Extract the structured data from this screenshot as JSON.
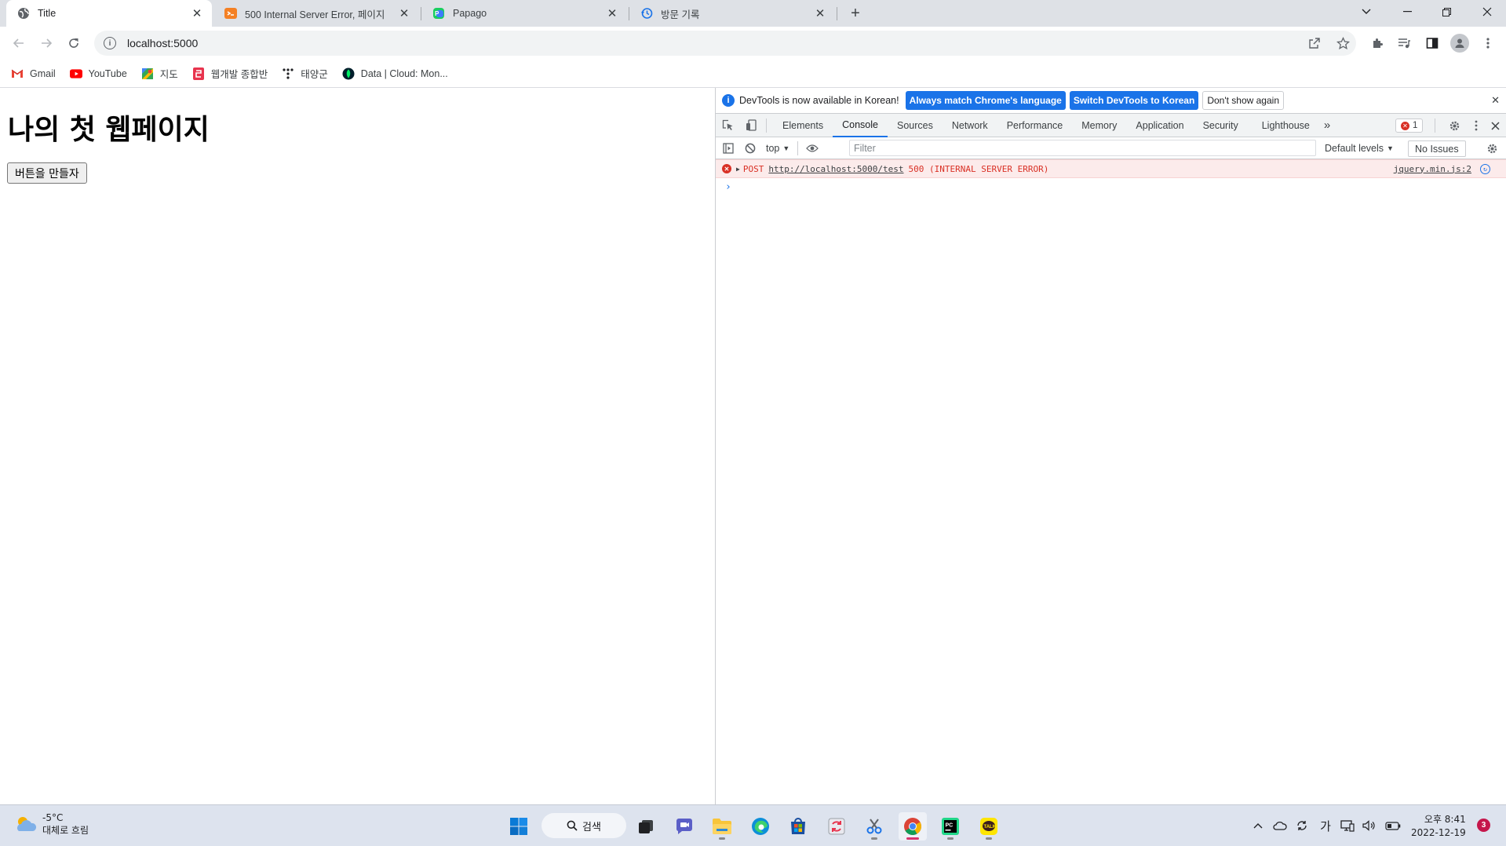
{
  "browser": {
    "tabs": [
      {
        "title": "Title",
        "active": true
      },
      {
        "title": "500 Internal Server Error, 페이지",
        "active": false
      },
      {
        "title": "Papago",
        "active": false
      },
      {
        "title": "방문 기록",
        "active": false
      }
    ],
    "url": "localhost:5000"
  },
  "bookmarks": [
    {
      "label": "Gmail"
    },
    {
      "label": "YouTube"
    },
    {
      "label": "지도"
    },
    {
      "label": "웹개발 종합반"
    },
    {
      "label": "태양군"
    },
    {
      "label": "Data | Cloud: Mon..."
    }
  ],
  "page": {
    "heading": "나의 첫 웹페이지",
    "button_label": "버튼을 만들자"
  },
  "devtools": {
    "infobar": {
      "message": "DevTools is now available in Korean!",
      "primary_button": "Always match Chrome's language",
      "secondary_button": "Switch DevTools to Korean",
      "dismiss_button": "Don't show again"
    },
    "tabs": [
      "Elements",
      "Console",
      "Sources",
      "Network",
      "Performance",
      "Memory",
      "Application",
      "Security",
      "Lighthouse"
    ],
    "active_tab": "Console",
    "error_count": "1",
    "console_bar": {
      "context": "top",
      "filter_placeholder": "Filter",
      "levels": "Default levels",
      "issues": "No Issues"
    },
    "messages": [
      {
        "method": "POST",
        "url": "http://localhost:5000/test",
        "status": "500 (INTERNAL SERVER ERROR)",
        "source": "jquery.min.js:2"
      }
    ]
  },
  "taskbar": {
    "weather_temp": "-5°C",
    "weather_desc": "대체로 흐림",
    "search_label": "검색",
    "ime": "가",
    "time": "오후 8:41",
    "date": "2022-12-19",
    "notification_count": "3"
  },
  "colors": {
    "accent": "#1a73e8",
    "error": "#d93025",
    "error_bg": "#fcebeb",
    "taskbar": "#dde3ee"
  }
}
